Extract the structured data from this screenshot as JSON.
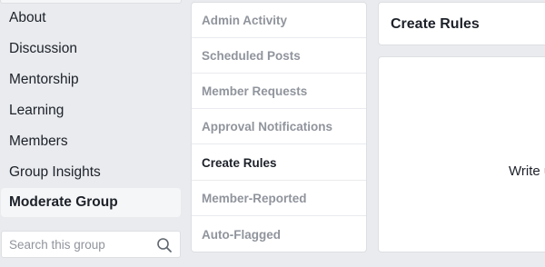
{
  "sidebar": {
    "items": [
      {
        "label": "About"
      },
      {
        "label": "Discussion"
      },
      {
        "label": "Mentorship"
      },
      {
        "label": "Learning"
      },
      {
        "label": "Members"
      },
      {
        "label": "Group Insights"
      },
      {
        "label": "Moderate Group",
        "active": true
      }
    ],
    "search": {
      "placeholder": "Search this group",
      "icon": "search-icon"
    }
  },
  "moderation_menu": {
    "items": [
      {
        "label": "Admin Activity"
      },
      {
        "label": "Scheduled Posts"
      },
      {
        "label": "Member Requests"
      },
      {
        "label": "Approval Notifications"
      },
      {
        "label": "Create Rules",
        "active": true
      },
      {
        "label": "Member-Reported"
      },
      {
        "label": "Auto-Flagged"
      }
    ]
  },
  "main": {
    "title": "Create Rules",
    "body_text": "Write u"
  },
  "colors": {
    "background": "#e9ebee",
    "card": "#ffffff",
    "border": "#dddfe2",
    "text_primary": "#1d2129",
    "text_muted": "#90949c"
  }
}
